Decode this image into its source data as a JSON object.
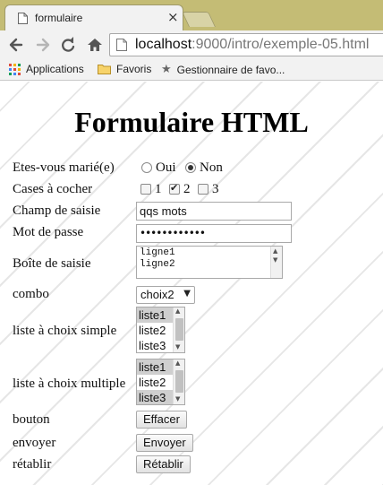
{
  "browser": {
    "tab_title": "formulaire",
    "tab_close": "×",
    "address_host": "localhost",
    "address_path": ":9000/intro/exemple-05.html",
    "bookmarks": [
      "Applications",
      "Favoris",
      "Gestionnaire de favo..."
    ]
  },
  "page": {
    "title": "Formulaire HTML",
    "married": {
      "label": "Etes-vous marié(e)",
      "options": [
        "Oui",
        "Non"
      ],
      "selected": "Non"
    },
    "checkboxes": {
      "label": "Cases à cocher",
      "options": [
        "1",
        "2",
        "3"
      ],
      "checked": [
        "2"
      ]
    },
    "text_field": {
      "label": "Champ de saisie",
      "value": "qqs mots"
    },
    "password": {
      "label": "Mot de passe",
      "masked": "••••••••••••"
    },
    "textarea": {
      "label": "Boîte de saisie",
      "lines": [
        "ligne1",
        "ligne2"
      ]
    },
    "combo": {
      "label": "combo",
      "value": "choix2"
    },
    "single_list": {
      "label": "liste à choix simple",
      "options": [
        "liste1",
        "liste2",
        "liste3"
      ],
      "selected": [
        "liste1"
      ]
    },
    "multi_list": {
      "label": "liste à choix multiple",
      "options": [
        "liste1",
        "liste2",
        "liste3"
      ],
      "selected": [
        "liste1",
        "liste3"
      ]
    },
    "button": {
      "label": "bouton",
      "button_text": "Effacer"
    },
    "submit": {
      "label": "envoyer",
      "button_text": "Envoyer"
    },
    "reset": {
      "label": "rétablir",
      "button_text": "Rétablir"
    }
  }
}
